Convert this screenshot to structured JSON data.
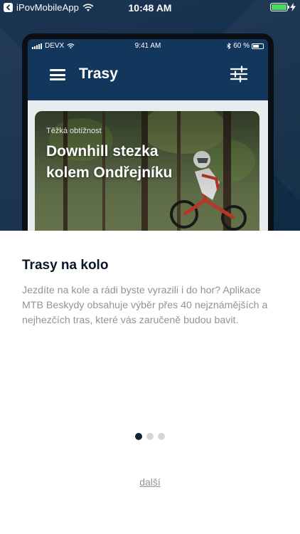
{
  "status_bar": {
    "app_name": "iPovMobileApp",
    "time": "10:48 AM",
    "battery_color": "#4cd964"
  },
  "mockup": {
    "status": {
      "carrier": "DEVX",
      "time": "9:41 AM",
      "battery": "60 %"
    },
    "app_title": "Trasy",
    "card": {
      "difficulty": "Těžká obtížnost",
      "title": "Downhill stezka kolem Ondřejníku"
    }
  },
  "onboarding": {
    "title": "Trasy na kolo",
    "description": "Jezdíte na kole a rádi byste vyrazili i do hor? Aplikace MTB Beskydy obsahuje výběr přes 40 nejznámějších a nejhezčích tras, které vás zaručeně budou bavit.",
    "page_count": 3,
    "current_page": 1,
    "next_label": "další"
  },
  "colors": {
    "hero_bg": "#15304d",
    "accent_dark": "#13253b",
    "muted_text": "#8e949a"
  }
}
